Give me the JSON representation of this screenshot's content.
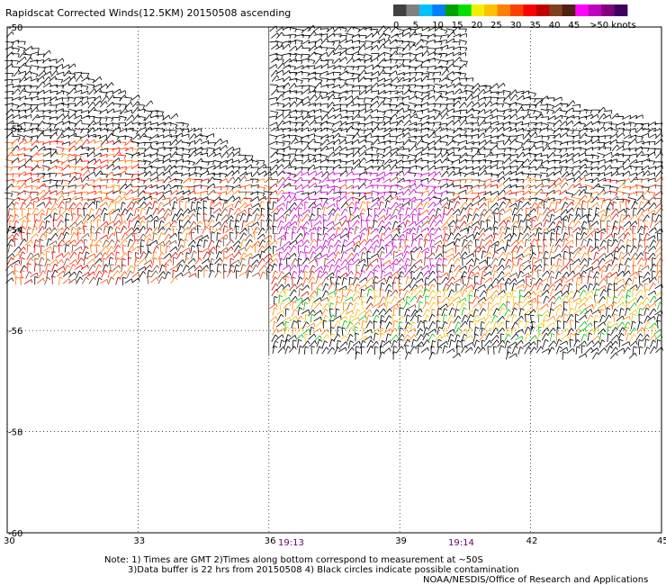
{
  "title": "Rapidscat Corrected Winds(12.5KM) 20150508 ascending",
  "legend": {
    "labels": [
      "0",
      "5",
      "10",
      "15",
      "20",
      "25",
      "30",
      "35",
      "40",
      "45",
      ">50 knots"
    ],
    "colors": [
      "#404040",
      "#808080",
      "#00c0ff",
      "#0080ff",
      "#00a000",
      "#00e000",
      "#f0f000",
      "#ffc000",
      "#ff8000",
      "#ff4000",
      "#ff0000",
      "#c00000",
      "#804020",
      "#502010",
      "#ff00ff",
      "#c000c0",
      "#800080",
      "#400060"
    ]
  },
  "map": {
    "lon_range": [
      30,
      45
    ],
    "lat_range": [
      -60,
      -50
    ],
    "lon_ticks": [
      "30",
      "33",
      "36",
      "39",
      "42",
      "45"
    ],
    "lat_ticks": [
      "-50",
      "-52",
      "-54",
      "-56",
      "-58",
      "-60"
    ],
    "grid": "dotted",
    "pass_times": [
      {
        "label": "19:13",
        "lon": 36.5
      },
      {
        "label": "19:14",
        "lon": 40.4
      }
    ]
  },
  "notes": {
    "line1": "Note: 1) Times are GMT 2)Times along bottom correspond to measurement at ~50S",
    "line2": "3)Data buffer is 22 hrs from 20150508 4) Black circles indicate possible contamination",
    "line3": "NOAA/NESDIS/Office of Research and Applications"
  }
}
